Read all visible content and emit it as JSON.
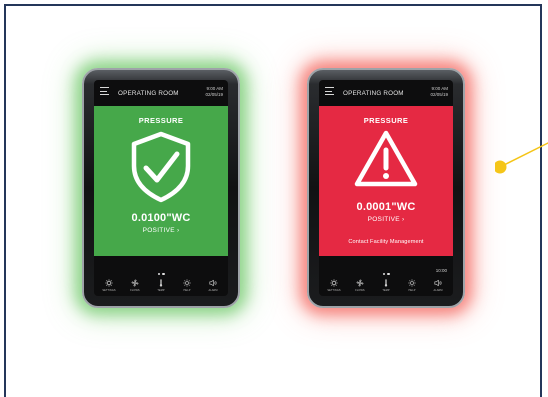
{
  "devices": [
    {
      "id": "normal",
      "title": "OPERATING ROOM",
      "time": "9:00 AM",
      "date": "02/05/19",
      "label": "PRESSURE",
      "status_icon": "shield-check-icon",
      "reading": "0.0100\"WC",
      "status": "POSITIVE",
      "message": "",
      "panel_color": "#46a84a",
      "glow_color": "#56be50"
    },
    {
      "id": "alarm",
      "title": "OPERATING ROOM",
      "time": "9:00 AM",
      "date": "02/05/19",
      "label": "PRESSURE",
      "status_icon": "warning-triangle-icon",
      "reading": "0.0001\"WC",
      "status": "POSITIVE",
      "message": "Contact Facility Management",
      "panel_color": "#e52943",
      "glow_color": "#f0463c",
      "bottom_time": "10:00"
    }
  ],
  "nav_items": [
    {
      "label": "SETTINGS",
      "icon": "gear-icon"
    },
    {
      "label": "FLOWS",
      "icon": "fan-icon"
    },
    {
      "label": "TEMP",
      "icon": "thermometer-icon"
    },
    {
      "label": "HELP",
      "icon": "sun-icon"
    },
    {
      "label": "ALARM",
      "icon": "speaker-icon"
    }
  ],
  "colors": {
    "frame_border": "#24365a",
    "callout": "#f5c518"
  }
}
